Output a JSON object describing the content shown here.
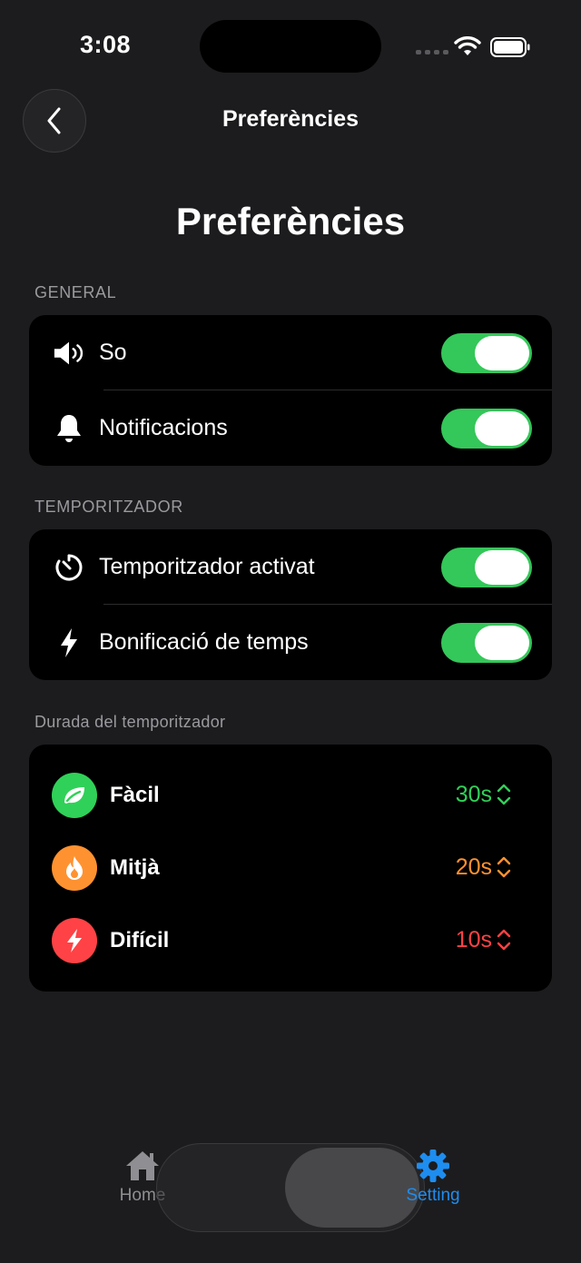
{
  "status_bar": {
    "time": "3:08"
  },
  "nav": {
    "title": "Preferències"
  },
  "page": {
    "title": "Preferències"
  },
  "general": {
    "section_label": "GENERAL",
    "items": [
      {
        "label": "So",
        "icon": "speaker-icon",
        "enabled": true
      },
      {
        "label": "Notificacions",
        "icon": "bell-icon",
        "enabled": true
      }
    ]
  },
  "timer": {
    "section_label": "TEMPORITZADOR",
    "items": [
      {
        "label": "Temporitzador activat",
        "icon": "timer-icon",
        "enabled": true
      },
      {
        "label": "Bonificació de temps",
        "icon": "bolt-icon",
        "enabled": true
      }
    ]
  },
  "duration": {
    "section_label": "Durada del temporitzador",
    "items": [
      {
        "label": "Fàcil",
        "value": "30s",
        "color": "#30d158",
        "icon": "leaf-icon"
      },
      {
        "label": "Mitjà",
        "value": "20s",
        "color": "#ff9230",
        "icon": "flame-icon"
      },
      {
        "label": "Difícil",
        "value": "10s",
        "color": "#ff4245",
        "icon": "bolt-icon"
      }
    ]
  },
  "tabbar": {
    "home_label": "Home",
    "setting_label": "Setting",
    "active": "Setting",
    "active_color": "#1e8df0"
  },
  "colors": {
    "toggle_on": "#34c759",
    "background": "#1c1c1e",
    "card": "#000000"
  }
}
